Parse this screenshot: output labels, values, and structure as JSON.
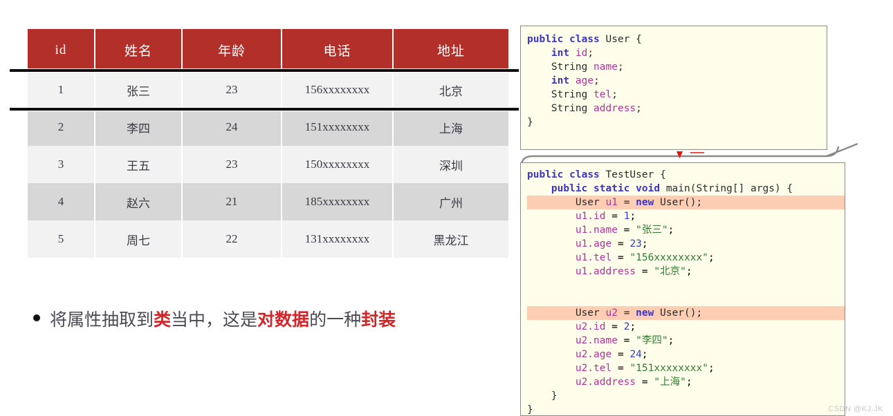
{
  "table": {
    "headers": [
      "id",
      "姓名",
      "年龄",
      "电话",
      "地址"
    ],
    "rows": [
      [
        "1",
        "张三",
        "23",
        "156xxxxxxxx",
        "北京"
      ],
      [
        "2",
        "李四",
        "24",
        "151xxxxxxxx",
        "上海"
      ],
      [
        "3",
        "王五",
        "23",
        "150xxxxxxxx",
        "深圳"
      ],
      [
        "4",
        "赵六",
        "21",
        "185xxxxxxxx",
        "广州"
      ],
      [
        "5",
        "周七",
        "22",
        "131xxxxxxxx",
        "黑龙江"
      ]
    ],
    "header_bg": "#b22f2a",
    "row_bg_odd": "#f2f2f2",
    "row_bg_even": "#d7d7d7"
  },
  "bullet": {
    "part1": "将属性抽取到",
    "em1": "类",
    "part2": "当中，这是",
    "em2": "对数据",
    "part3": "的一种",
    "em3": "封装",
    "emphasis_color": "#d1262a"
  },
  "code_user": {
    "l1_kw1": "public",
    "l1_kw2": "class",
    "l1_name": "User",
    "l1_brace": "{",
    "l2_kw": "int",
    "l2_fld": "id",
    "l2_semi": ";",
    "l3_typ": "String",
    "l3_fld": "name",
    "l3_semi": ";",
    "l4_kw": "int",
    "l4_fld": "age",
    "l4_semi": ";",
    "l5_typ": "String",
    "l5_fld": "tel",
    "l5_semi": ";",
    "l6_typ": "String",
    "l6_fld": "address",
    "l6_semi": ";",
    "l7_brace": "}"
  },
  "code_test": {
    "l1_kw1": "public",
    "l1_kw2": "class",
    "l1_name": "TestUser",
    "l1_brace": "{",
    "l2_kw1": "public",
    "l2_kw2": "static",
    "l2_kw3": "void",
    "l2_name": "main",
    "l2_sig": "(String[] args) {",
    "u1": {
      "decl_typ": "User",
      "decl_var": "u1",
      "decl_eq": "=",
      "decl_kw": "new",
      "decl_call": "User();",
      "id_lhs": "u1.id",
      "id_val": "1",
      "name_lhs": "u1.name",
      "name_val": "\"张三\"",
      "age_lhs": "u1.age",
      "age_val": "23",
      "tel_lhs": "u1.tel",
      "tel_val": "\"156xxxxxxxx\"",
      "addr_lhs": "u1.address",
      "addr_val": "\"北京\""
    },
    "u2": {
      "decl_typ": "User",
      "decl_var": "u2",
      "decl_eq": "=",
      "decl_kw": "new",
      "decl_call": "User();",
      "id_lhs": "u2.id",
      "id_val": "2",
      "name_lhs": "u2.name",
      "name_val": "\"李四\"",
      "age_lhs": "u2.age",
      "age_val": "24",
      "tel_lhs": "u2.tel",
      "tel_val": "\"151xxxxxxxx\"",
      "addr_lhs": "u2.address",
      "addr_val": "\"上海\""
    },
    "close_inner": "}",
    "close_outer": "}",
    "highlight_color": "#fdcdb4"
  },
  "watermark": "CSDN @KJ.JK"
}
